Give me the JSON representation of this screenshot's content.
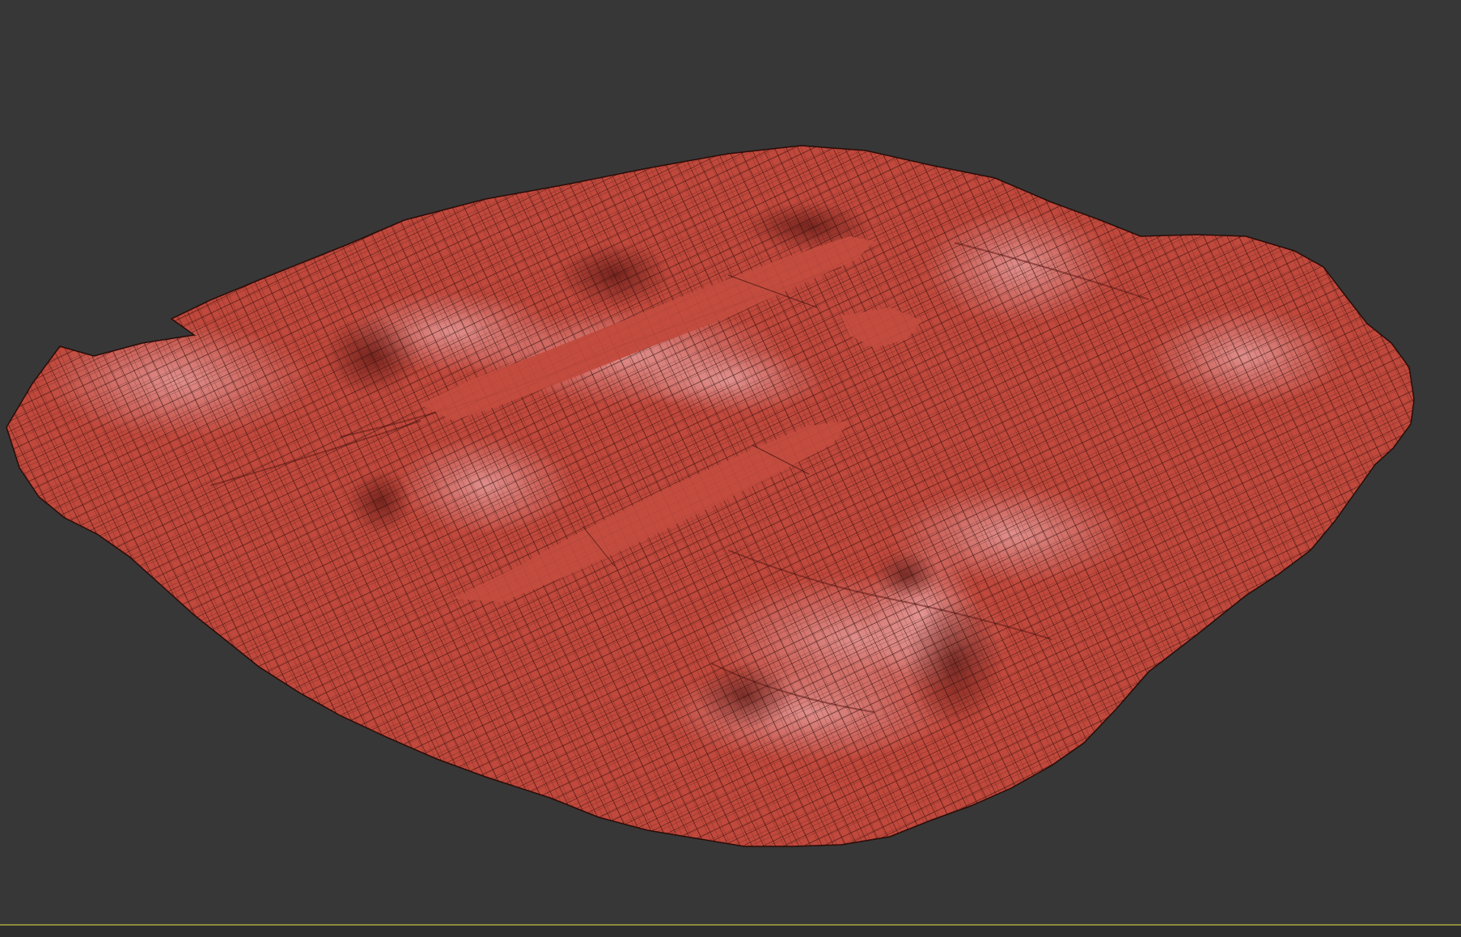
{
  "viewport": {
    "background_color": "#373737",
    "frame_line_color": "#8c8a3a"
  },
  "mesh": {
    "object": "terrain-mesh",
    "display_mode": "wireframe-on-shaded",
    "surface_color": "#c0483c",
    "highlight_color": "#d98a8a",
    "shadow_color": "#7a2620",
    "wire_color": "#2a0c08",
    "feature_count": {
      "channels": 2,
      "ridges": 2
    }
  }
}
